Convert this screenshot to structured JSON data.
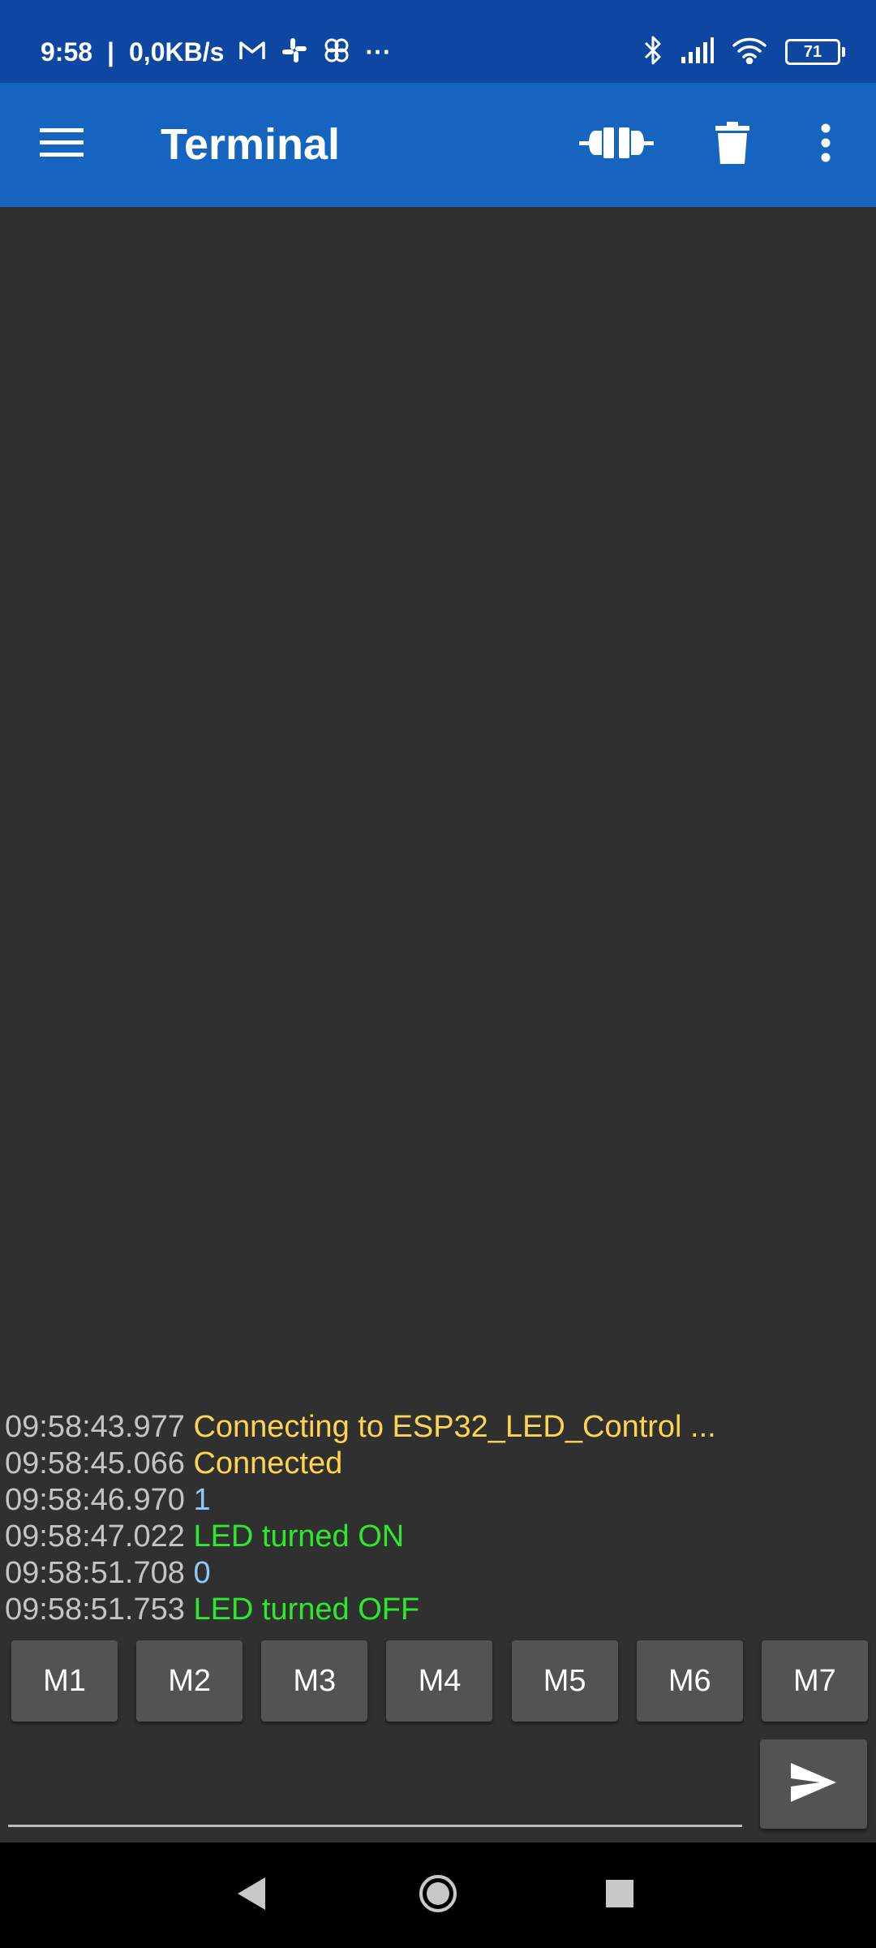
{
  "status_bar": {
    "time": "9:58",
    "speed": "0,0KB/s",
    "more_indicator": "···",
    "battery": "71",
    "icons": [
      "gmail-icon",
      "slack-icon",
      "pinwheel-app-icon",
      "bluetooth-icon",
      "signal-icon",
      "wifi-icon",
      "battery-icon"
    ]
  },
  "app_bar": {
    "title": "Terminal",
    "icons": [
      "menu-icon",
      "connect-icon",
      "trash-icon",
      "more-vert-icon"
    ]
  },
  "log": [
    {
      "time": "09:58:43.977",
      "text": "Connecting to ESP32_LED_Control ...",
      "color": "#ffd54f"
    },
    {
      "time": "09:58:45.066",
      "text": "Connected",
      "color": "#ffd54f"
    },
    {
      "time": "09:58:46.970",
      "text": "1",
      "color": "#90caf9"
    },
    {
      "time": "09:58:47.022",
      "text": "LED turned ON",
      "color": "#2ee82e"
    },
    {
      "time": "09:58:51.708",
      "text": "0",
      "color": "#90caf9"
    },
    {
      "time": "09:58:51.753",
      "text": "LED turned OFF",
      "color": "#2ee82e"
    }
  ],
  "macros": [
    "M1",
    "M2",
    "M3",
    "M4",
    "M5",
    "M6",
    "M7"
  ],
  "input": {
    "value": "",
    "placeholder": ""
  },
  "colors": {
    "status_bar": "#0d47a1",
    "app_bar": "#1565c0",
    "background": "#303030",
    "button": "#535353",
    "timestamp": "#c4c4c4"
  }
}
